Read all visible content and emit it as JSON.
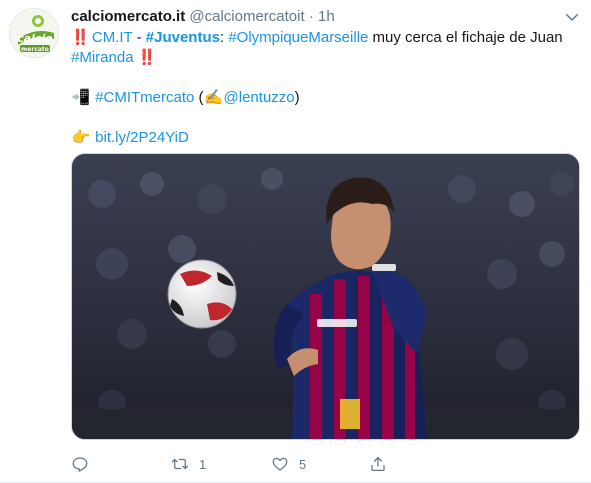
{
  "tweet": {
    "avatar_alt": "calciomercato",
    "display_name": "calciomercato.it",
    "handle": "@calciomercatoit",
    "separator": "·",
    "timestamp": "1h",
    "line1_mark": "‼️",
    "line1_cmit": "CM.IT",
    "line1_dash": " - ",
    "line1_juventus": "#Juventus",
    "line1_colon": ": ",
    "line1_om": "#OlympiqueMarseille",
    "line1_rest": " muy cerca el fichaje de Juan",
    "line2_miranda": "#Miranda",
    "line2_mark": "‼️",
    "line3_icon": "📲",
    "line3_tag": "#CMITmercato",
    "line3_open": " (",
    "line3_pen": "✍️",
    "line3_user": "@lentuzzo",
    "line3_close": ")",
    "line4_icon": "👉",
    "line4_link": "bit.ly/2P24YiD"
  },
  "actions": {
    "reply_count": "",
    "retweet_count": "1",
    "like_count": "5"
  },
  "colors": {
    "link": "#1b95e0",
    "muted": "#657786",
    "accent_red": "#e0245e"
  },
  "icons": [
    "calciomercato-logo",
    "chevron-down-icon",
    "reply-icon",
    "retweet-icon",
    "like-icon",
    "share-icon"
  ]
}
